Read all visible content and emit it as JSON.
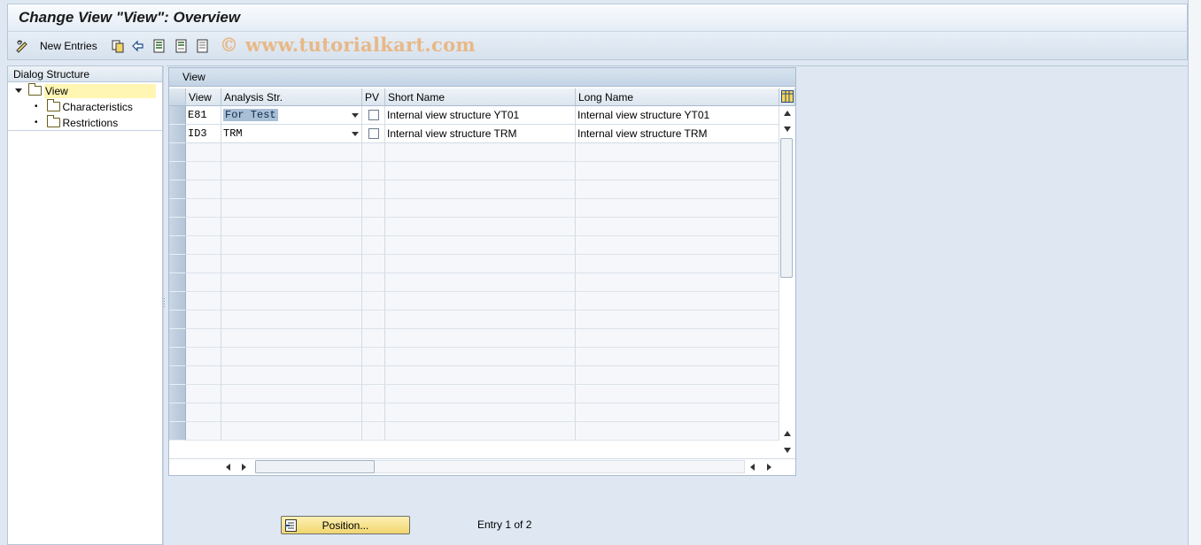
{
  "title": "Change View \"View\": Overview",
  "toolbar": {
    "new_entries_label": "New Entries",
    "icons": [
      "edit-glasses-icon",
      "copy-as-icon",
      "undo-icon",
      "select-all-icon",
      "select-block-icon",
      "deselect-all-icon"
    ]
  },
  "watermark": "© www.tutorialkart.com",
  "nav": {
    "header": "Dialog Structure",
    "items": [
      {
        "label": "View",
        "selected": true,
        "expanded": true
      },
      {
        "label": "Characteristics"
      },
      {
        "label": "Restrictions"
      }
    ]
  },
  "table": {
    "caption": "View",
    "columns": [
      "View",
      "Analysis Str.",
      "PV",
      "Short Name",
      "Long Name"
    ],
    "rows": [
      {
        "view": "E81",
        "analysis_str": "For Test",
        "pv": false,
        "short_name": "Internal view structure YT01",
        "long_name": "Internal view structure YT01"
      },
      {
        "view": "ID3",
        "analysis_str": "TRM",
        "pv": false,
        "short_name": "Internal view structure TRM",
        "long_name": "Internal view structure TRM"
      }
    ]
  },
  "footer": {
    "position_label": "Position...",
    "entry_info": "Entry 1 of 2"
  },
  "colors": {
    "background": "#dfe8f2",
    "button_yellow": "#f0d56e",
    "selected_tree": "#fff6b3",
    "watermark": "#e8b887"
  }
}
